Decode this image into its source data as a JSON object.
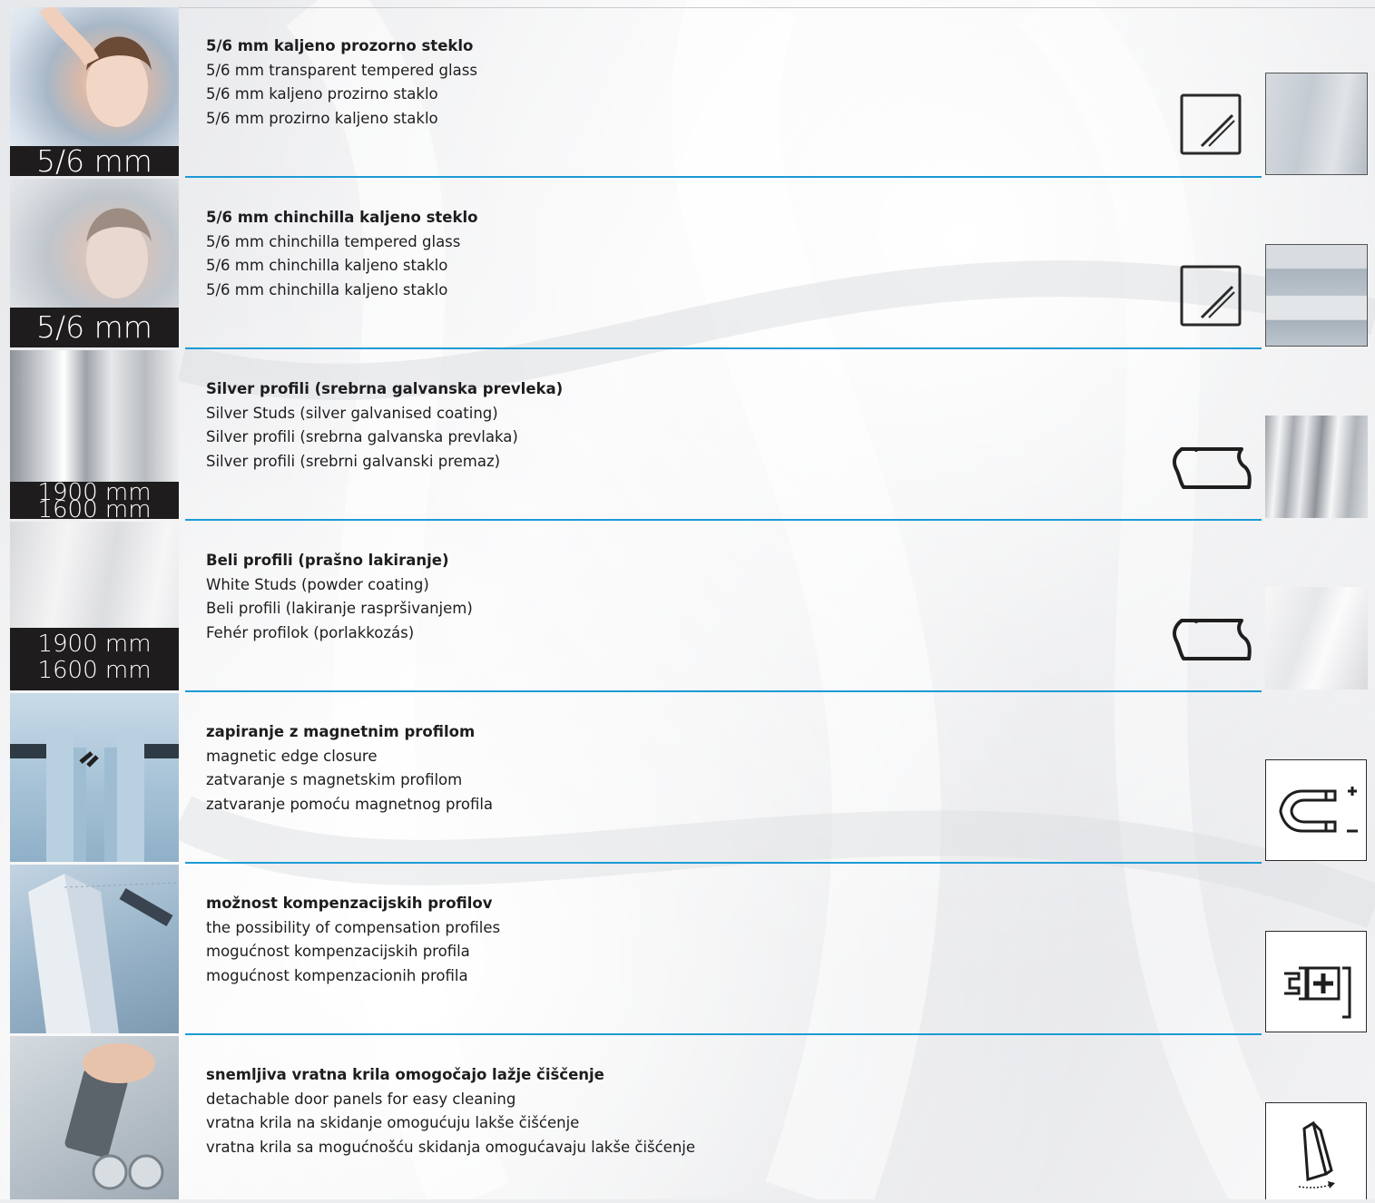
{
  "rows": [
    {
      "label_lines": [
        "5/6 mm",
        ""
      ],
      "lines": [
        "5/6 mm kaljeno prozorno steklo",
        "5/6 mm transparent tempered glass",
        "5/6 mm kaljeno prozirno staklo",
        "5/6 mm prozirno kaljeno staklo"
      ],
      "icon": "glass-icon",
      "swatch": "transparent-glass"
    },
    {
      "label_lines": [
        "5/6 mm",
        ""
      ],
      "lines": [
        "5/6 mm chinchilla kaljeno steklo",
        "5/6 mm chinchilla tempered glass",
        "5/6 mm chinchilla kaljeno staklo",
        "5/6 mm chinchilla kaljeno staklo"
      ],
      "icon": "glass-icon",
      "swatch": "chinchilla-glass"
    },
    {
      "label_lines": [
        "1900 mm",
        "1600 mm"
      ],
      "lines": [
        "Silver profili (srebrna galvanska prevleka)",
        "Silver Studs (silver galvanised coating)",
        "Silver profili (srebrna galvanska prevlaka)",
        "Silver profili (srebrni galvanski premaz)"
      ],
      "icon": "profile-icon",
      "swatch": "silver-profile"
    },
    {
      "label_lines": [
        "1900 mm",
        "1600 mm"
      ],
      "lines": [
        "Beli profili (prašno lakiranje)",
        "White Studs (powder coating)",
        "Beli profili (lakiranje raspršivanjem)",
        "Fehér profilok (porlakkozás)"
      ],
      "icon": "profile-icon",
      "swatch": "white-profile"
    },
    {
      "label_lines": [
        "",
        ""
      ],
      "lines": [
        "zapiranje z magnetnim profilom",
        "magnetic edge closure",
        "zatvaranje s magnetskim profilom",
        "zatvaranje pomoću magnetnog profila"
      ],
      "icon": "magnet-icon",
      "swatch": ""
    },
    {
      "label_lines": [
        "",
        ""
      ],
      "lines": [
        "možnost kompenzacijskih profilov",
        "the possibility of compensation profiles",
        "mogućnost kompenzacijskih profila",
        "mogućnost kompenzacionih profila"
      ],
      "icon": "compensation-profile-icon",
      "swatch": ""
    },
    {
      "label_lines": [
        "",
        ""
      ],
      "lines": [
        "snemljiva vratna krila omogočajo lažje čiščenje",
        "detachable door panels for easy cleaning",
        "vratna krila na skidanje omogućuju lakše čišćenje",
        "vratna krila sa mogućnošću skidanja omogućavaju lakše čišćenje"
      ],
      "icon": "detachable-door-icon",
      "swatch": ""
    }
  ],
  "colors": {
    "accent": "#1d9ad6",
    "label_bg": "#1f1c1d",
    "text": "#1d1d1f"
  }
}
